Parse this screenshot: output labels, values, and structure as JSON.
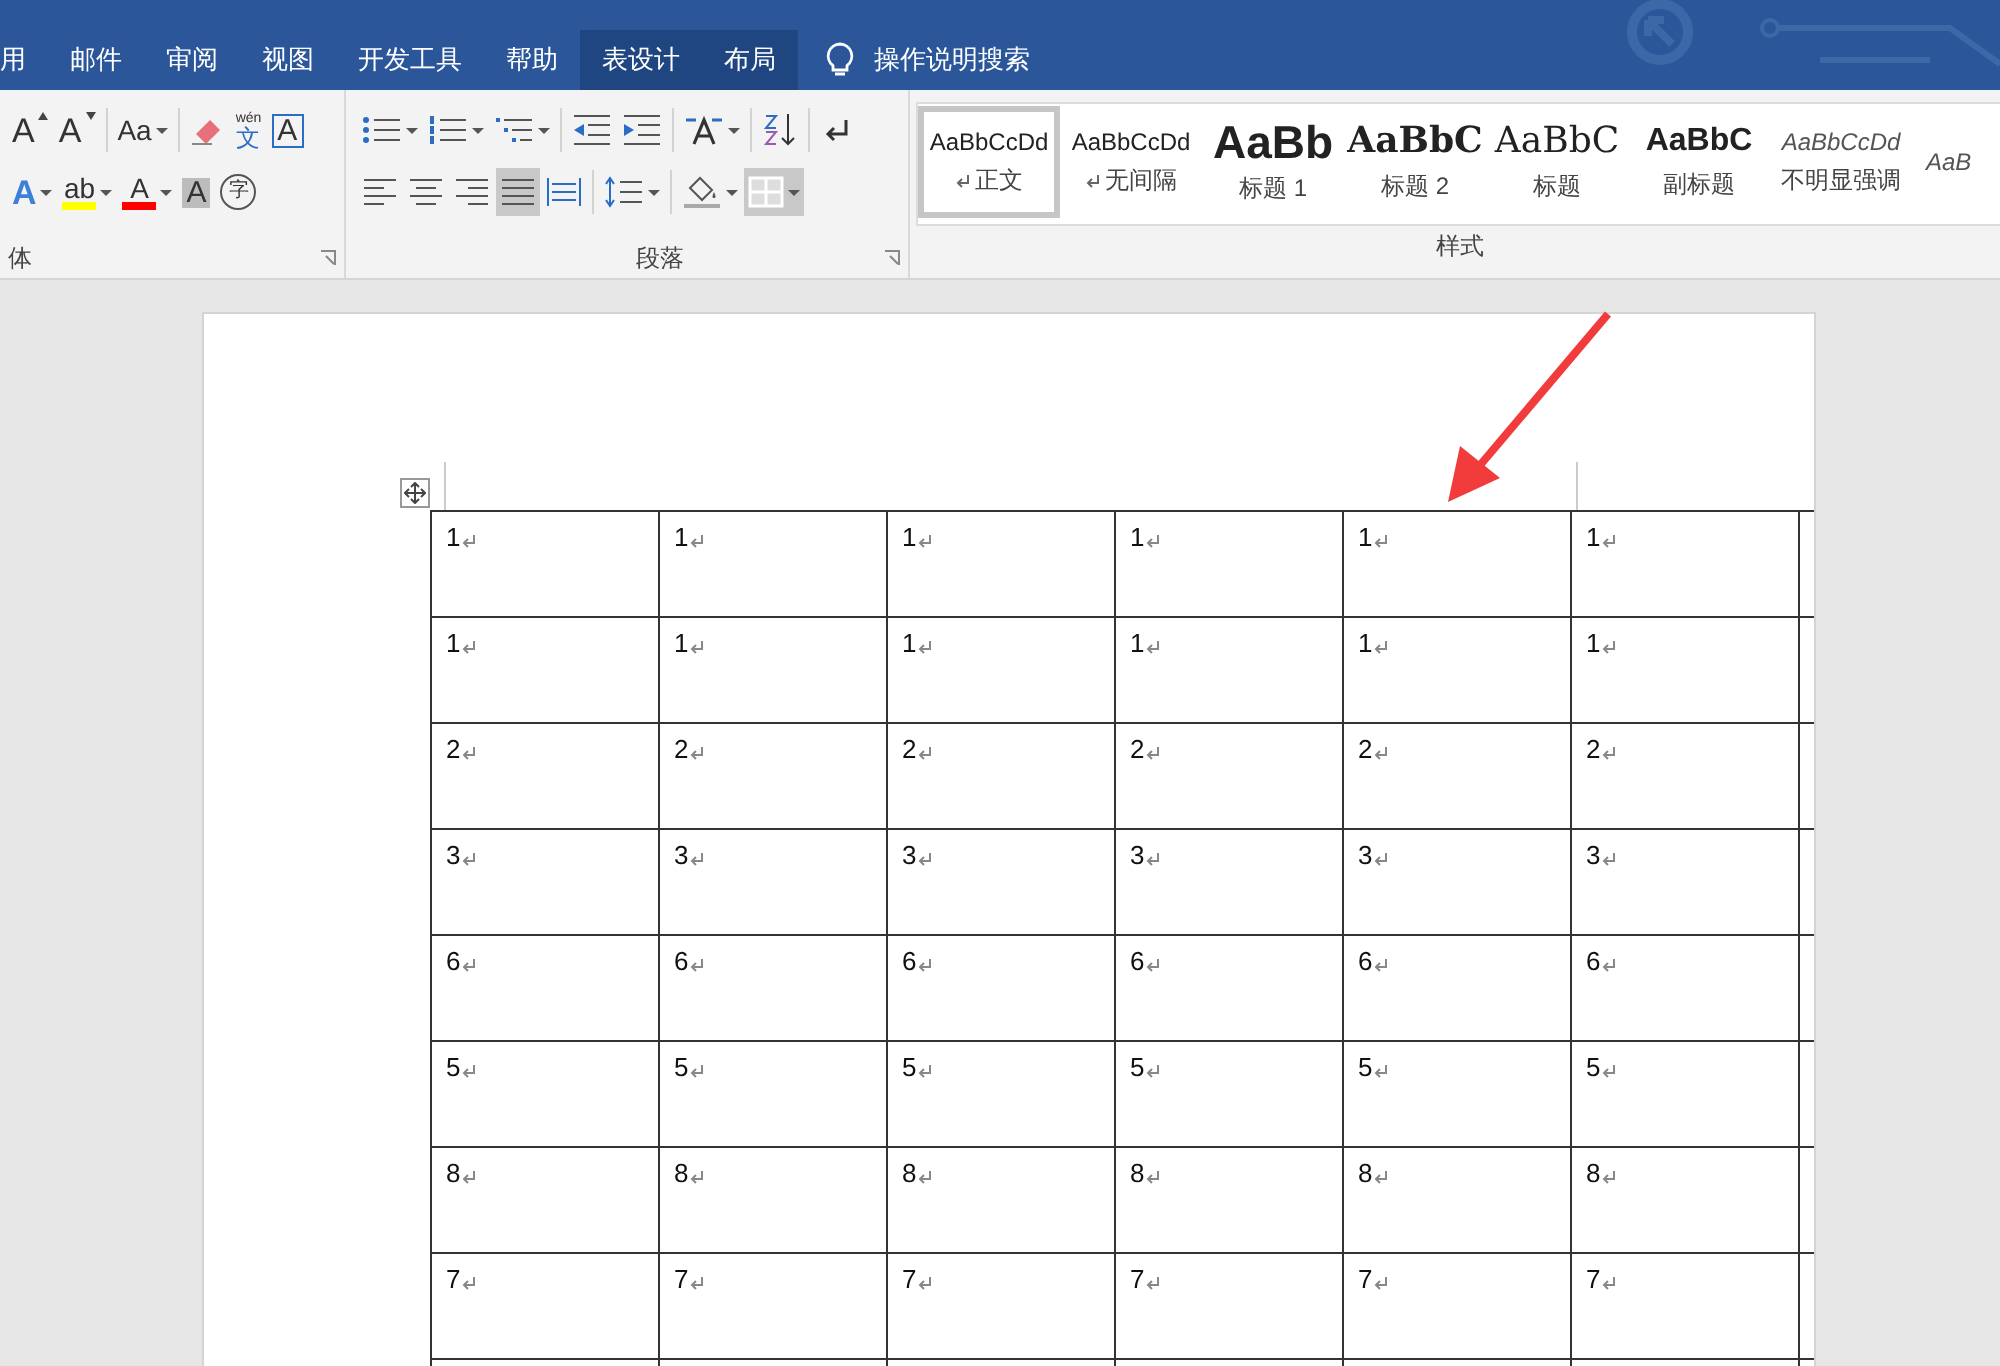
{
  "tabs": [
    {
      "label": "用",
      "kind": "normal"
    },
    {
      "label": "邮件",
      "kind": "normal"
    },
    {
      "label": "审阅",
      "kind": "normal"
    },
    {
      "label": "视图",
      "kind": "normal"
    },
    {
      "label": "开发工具",
      "kind": "normal"
    },
    {
      "label": "帮助",
      "kind": "normal"
    },
    {
      "label": "表设计",
      "kind": "contextual"
    },
    {
      "label": "布局",
      "kind": "contextual"
    }
  ],
  "tell_me": {
    "placeholder": "操作说明搜索"
  },
  "font_group": {
    "label": "体",
    "rows": [
      [
        {
          "kind": "grow",
          "glyph": "A"
        },
        {
          "kind": "shrink",
          "glyph": "A"
        },
        {
          "kind": "case",
          "glyph": "Aa"
        },
        {
          "kind": "eraser"
        },
        {
          "kind": "phonetic",
          "glyph": "文",
          "small": "wén"
        },
        {
          "kind": "boxed",
          "glyph": "A"
        }
      ],
      [
        {
          "kind": "effects",
          "glyph": "A"
        },
        {
          "kind": "highlight",
          "glyph": "ab",
          "color": "#ffff00"
        },
        {
          "kind": "fontcolor",
          "glyph": "A",
          "color": "#ff0000"
        },
        {
          "kind": "shading",
          "glyph": "A"
        },
        {
          "kind": "enclosed",
          "glyph": "字"
        }
      ]
    ]
  },
  "paragraph_group": {
    "label": "段落",
    "rows": [
      [
        {
          "kind": "bullets",
          "selected": false
        },
        {
          "kind": "numbering",
          "selected": false
        },
        {
          "kind": "multilevel",
          "selected": false
        },
        {
          "kind": "outdent",
          "selected": false
        },
        {
          "kind": "indent",
          "selected": false
        },
        {
          "kind": "asian",
          "selected": false
        },
        {
          "kind": "sort",
          "selected": false
        },
        {
          "kind": "marks",
          "selected": false
        }
      ],
      [
        {
          "kind": "left",
          "selected": false
        },
        {
          "kind": "center",
          "selected": false
        },
        {
          "kind": "right",
          "selected": false
        },
        {
          "kind": "justify",
          "selected": true
        },
        {
          "kind": "distributed",
          "selected": false
        },
        {
          "kind": "spacing",
          "selected": false
        },
        {
          "kind": "fill",
          "selected": false
        },
        {
          "kind": "borders",
          "selected": true
        }
      ]
    ]
  },
  "styles_group": {
    "label": "样式",
    "items": [
      {
        "preview": "AaBbCcDd",
        "label": "正文",
        "kind": "normal",
        "selected": true
      },
      {
        "preview": "AaBbCcDd",
        "label": "无间隔",
        "kind": "normal",
        "selected": false
      },
      {
        "preview": "AaBb",
        "label": "标题 1",
        "kind": "h1",
        "selected": false
      },
      {
        "preview": "AaBbC",
        "label": "标题 2",
        "kind": "h2",
        "selected": false
      },
      {
        "preview": "AaBbC",
        "label": "标题",
        "kind": "title",
        "selected": false
      },
      {
        "preview": "AaBbC",
        "label": "副标题",
        "kind": "subtitle",
        "selected": false
      },
      {
        "preview": "AaBbCcDd",
        "label": "不明显强调",
        "kind": "emphasis",
        "selected": false
      },
      {
        "preview": "AaB",
        "kind": "emphasis",
        "selected": false
      }
    ]
  },
  "table": {
    "rows": [
      [
        "1",
        "1",
        "1",
        "1",
        "1",
        "1"
      ],
      [
        "1",
        "1",
        "1",
        "1",
        "1",
        "1"
      ],
      [
        "2",
        "2",
        "2",
        "2",
        "2",
        "2"
      ],
      [
        "3",
        "3",
        "3",
        "3",
        "3",
        "3"
      ],
      [
        "6",
        "6",
        "6",
        "6",
        "6",
        "6"
      ],
      [
        "5",
        "5",
        "5",
        "5",
        "5",
        "5"
      ],
      [
        "8",
        "8",
        "8",
        "8",
        "8",
        "8"
      ],
      [
        "7",
        "7",
        "7",
        "7",
        "7",
        "7"
      ]
    ]
  }
}
